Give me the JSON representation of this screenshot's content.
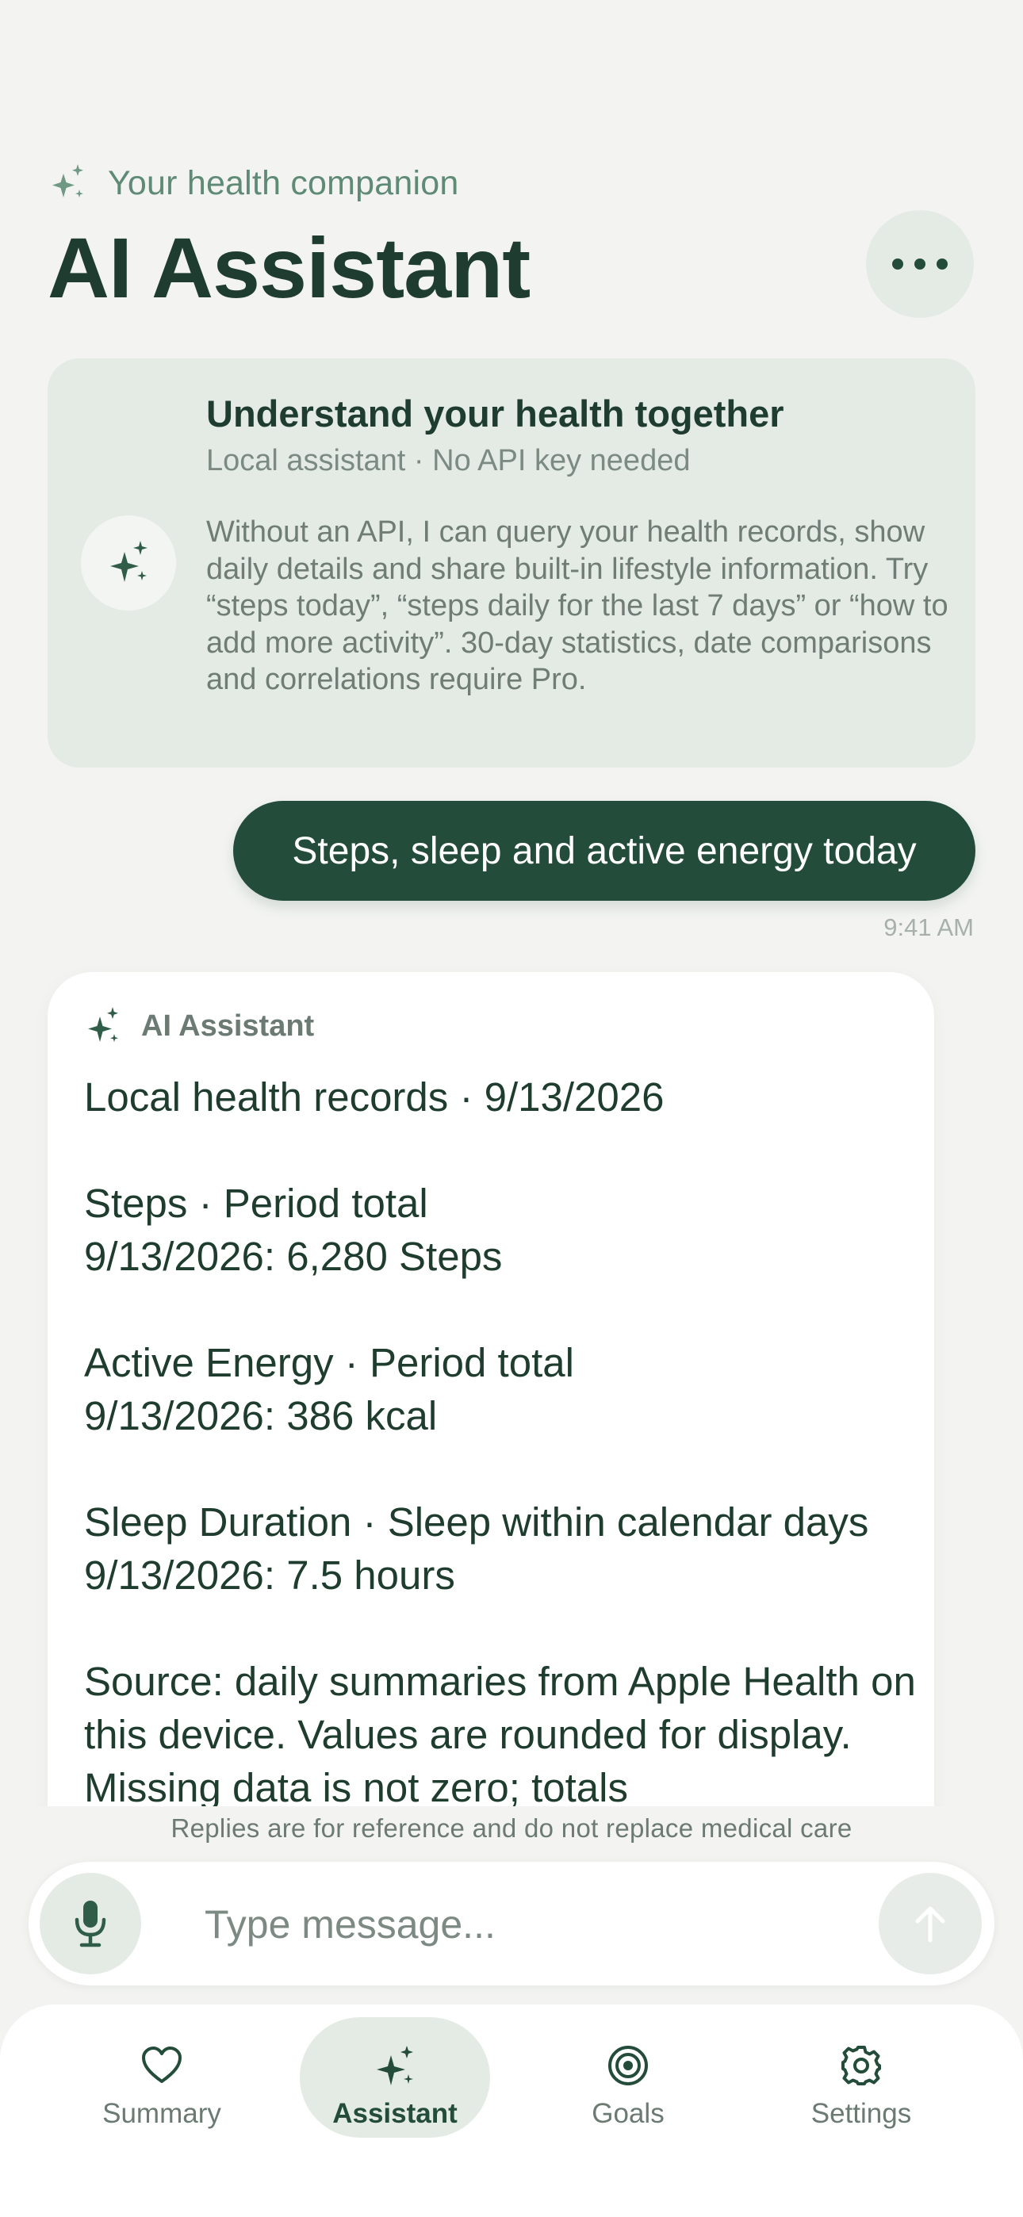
{
  "header": {
    "subtitle": "Your health companion",
    "title": "AI Assistant"
  },
  "intro": {
    "title": "Understand your health together",
    "subtitle": "Local assistant · No API key needed",
    "body": "Without an API, I can query your health records, show daily details and share built-in lifestyle information. Try “steps today”, “steps daily for the last 7 days” or “how to add more activity”. 30-day statistics, date comparisons and correlations require Pro."
  },
  "user_message": {
    "text": "Steps, sleep and active energy today",
    "time": "9:41 AM"
  },
  "assistant_message": {
    "label": "AI Assistant",
    "text": "Local health records · 9/13/2026\n\nSteps · Period total\n9/13/2026: 6,280 Steps\n\nActive Energy · Period total\n9/13/2026: 386 kcal\n\nSleep Duration · Sleep within calendar days\n9/13/2026: 7.5 hours\n\nSource: daily summaries from Apple Health on this device. Values are rounded for display. Missing data is not zero; totals"
  },
  "disclaimer": "Replies are for reference and do not replace medical care",
  "composer": {
    "placeholder": "Type message..."
  },
  "tabs": [
    {
      "label": "Summary",
      "icon": "heart-icon",
      "active": false
    },
    {
      "label": "Assistant",
      "icon": "sparkle-icon",
      "active": true
    },
    {
      "label": "Goals",
      "icon": "target-icon",
      "active": false
    },
    {
      "label": "Settings",
      "icon": "gear-icon",
      "active": false
    }
  ],
  "colors": {
    "background": "#f3f4f1",
    "accent": "#234d3a",
    "card": "#e4ebe5"
  }
}
